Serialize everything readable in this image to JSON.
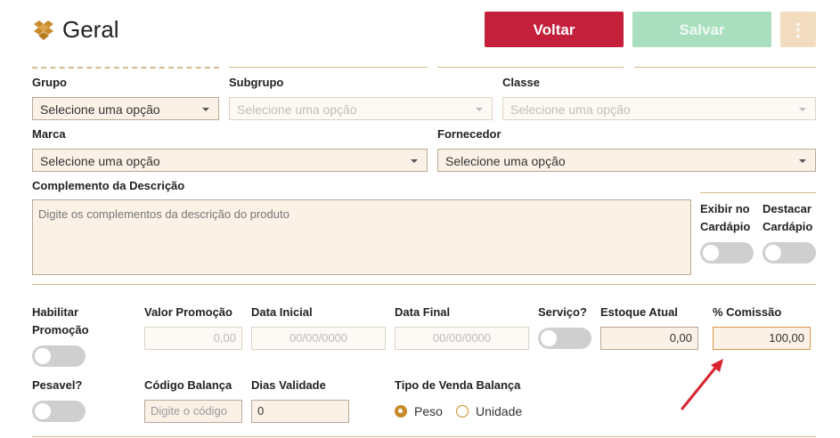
{
  "header": {
    "title": "Geral",
    "voltar_label": "Voltar",
    "salvar_label": "Salvar",
    "more_label": "⋮"
  },
  "fields": {
    "grupo": {
      "label": "Grupo",
      "value": "Selecione uma opção"
    },
    "subgrupo": {
      "label": "Subgrupo",
      "value": "Selecione uma opção"
    },
    "classe": {
      "label": "Classe",
      "value": "Selecione uma opção"
    },
    "marca": {
      "label": "Marca",
      "value": "Selecione uma opção"
    },
    "fornecedor": {
      "label": "Fornecedor",
      "value": "Selecione uma opção"
    },
    "complemento": {
      "label": "Complemento da Descrição",
      "placeholder": "Digite os complementos da descrição do produto"
    },
    "exibir_cardapio": {
      "label_line1": "Exibir no",
      "label_line2": "Cardápio"
    },
    "destacar_cardapio": {
      "label_line1": "Destacar",
      "label_line2": "Cardápio"
    },
    "habilitar_promocao": {
      "label_line1": "Habilitar",
      "label_line2": "Promoção"
    },
    "valor_promocao": {
      "label": "Valor Promoção",
      "value": "0,00"
    },
    "data_inicial": {
      "label": "Data Inicial",
      "value": "00/00/0000"
    },
    "data_final": {
      "label": "Data Final",
      "value": "00/00/0000"
    },
    "servico": {
      "label": "Serviço?"
    },
    "estoque_atual": {
      "label": "Estoque Atual",
      "value": "0,00"
    },
    "comissao": {
      "label": "% Comissão",
      "value": "100,00"
    },
    "pesavel": {
      "label": "Pesavel?"
    },
    "codigo_balanca": {
      "label": "Código Balança",
      "placeholder": "Digite o código"
    },
    "dias_validade": {
      "label": "Dias Validade",
      "value": "0"
    },
    "tipo_venda_balanca": {
      "label": "Tipo de Venda Balança",
      "options": [
        "Peso",
        "Unidade"
      ],
      "selected": "Peso"
    }
  },
  "colors": {
    "voltar": "#c41f3b",
    "salvar": "#a9dfbf",
    "accent": "#c88a2b",
    "annotation_arrow": "#d9232f"
  },
  "icons": {
    "logo": "box-logo-icon",
    "more": "kebab-menu-icon",
    "annotation": "red-arrow-annotation"
  }
}
